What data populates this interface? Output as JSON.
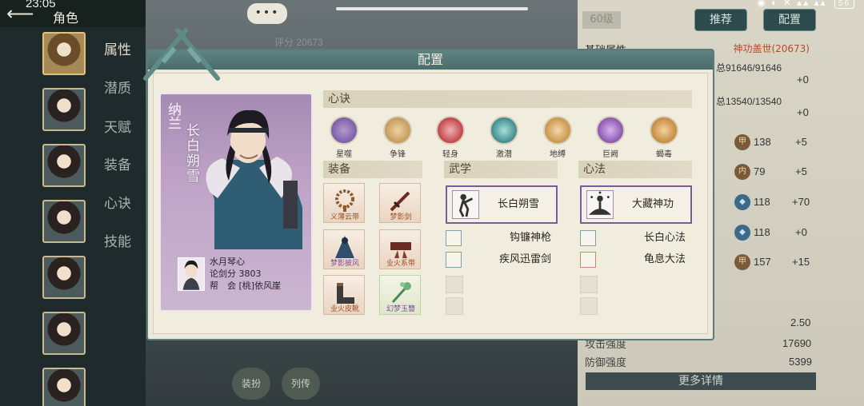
{
  "status": {
    "time": "23:05",
    "battery": "56"
  },
  "header": {
    "back_icon": "back-arrow-icon",
    "title": "角色"
  },
  "sidebar": {
    "tabs": [
      {
        "label": "属性",
        "active": true
      },
      {
        "label": "潜质"
      },
      {
        "label": "天赋"
      },
      {
        "label": "装备"
      },
      {
        "label": "心诀"
      },
      {
        "label": "技能"
      }
    ]
  },
  "background": {
    "score_label": "评分",
    "score_value": "20673",
    "level": "60级",
    "recommend_btn": "推荐",
    "config_btn": "配置",
    "base_attr_label": "基础属性",
    "set_name": "神功盖世(20673)",
    "hp": "总91646/91646",
    "hp_plus": "+0",
    "mp": "总13540/13540",
    "mp_plus": "+0",
    "attr_rows": [
      {
        "value": "138",
        "plus": "+5"
      },
      {
        "value": "79",
        "plus": "+5"
      },
      {
        "value": "118",
        "plus": "+70"
      },
      {
        "value": "118",
        "plus": "+0"
      },
      {
        "value": "157",
        "plus": "+15"
      }
    ],
    "speed_value": "2.50",
    "attack_label": "攻击强度",
    "attack_value": "17690",
    "defense_label": "防御强度",
    "defense_value": "5399",
    "more_details": "更多详情",
    "bottom_btn_1": "装扮",
    "bottom_btn_2": "列传"
  },
  "modal": {
    "title": "配置",
    "character": {
      "surname": "纳兰",
      "name": "长白朔雪",
      "player_name": "水月琴心",
      "score_label": "论剑分",
      "score_value": "3803",
      "guild_label": "帮　会",
      "guild_value": "[桃]依风崖"
    },
    "xinjue": {
      "title": "心诀",
      "items": [
        {
          "label": "星噬",
          "color": "#7b5ea7"
        },
        {
          "label": "争锋",
          "color": "#c49a5a"
        },
        {
          "label": "轻身",
          "color": "#c0454a"
        },
        {
          "label": "激潜",
          "color": "#3f8a8d"
        },
        {
          "label": "地缚",
          "color": "#c9954a"
        },
        {
          "label": "巨阙",
          "color": "#8b55b0"
        },
        {
          "label": "蝎毒",
          "color": "#c58a3e"
        }
      ]
    },
    "equipment": {
      "title": "装备",
      "items": [
        {
          "label": "义薄云带",
          "style": "orange"
        },
        {
          "label": "梦影剑",
          "style": "orange"
        },
        {
          "label": "梦影披风",
          "style": "purple"
        },
        {
          "label": "业火系带",
          "style": "orange"
        },
        {
          "label": "业火皮靴",
          "style": "orange"
        },
        {
          "label": "幻梦玉簪",
          "style": "green"
        }
      ]
    },
    "martial": {
      "title": "武学",
      "main": "长白朔雪",
      "skills": [
        "钩镰神枪",
        "疾风迅雷剑"
      ]
    },
    "mind": {
      "title": "心法",
      "main": "大藏神功",
      "skills": [
        "长白心法",
        "龟息大法"
      ]
    }
  }
}
